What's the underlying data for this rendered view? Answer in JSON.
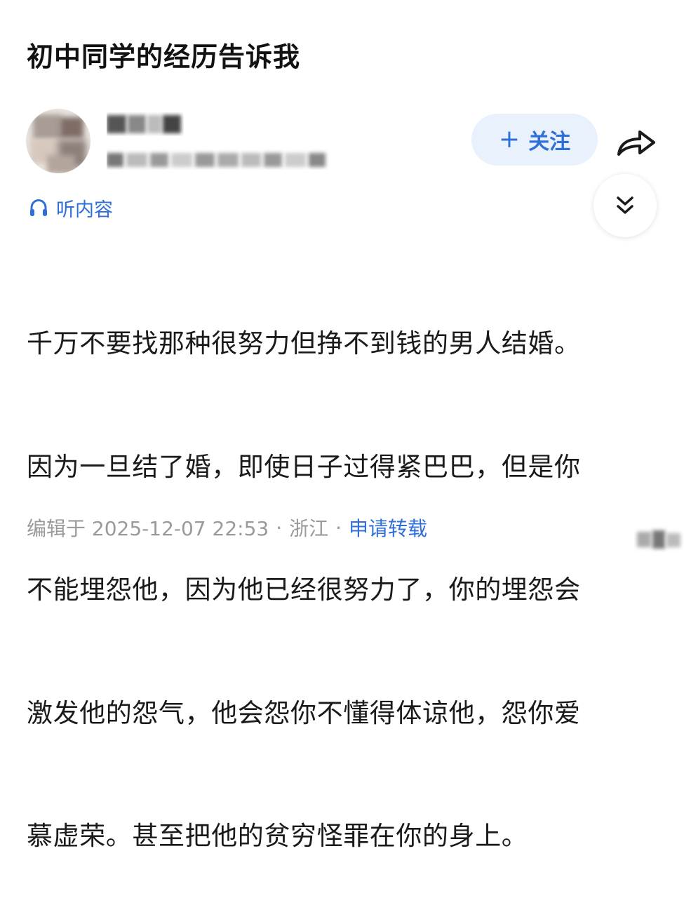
{
  "post": {
    "title": "初中同学的经历告诉我"
  },
  "author": {
    "follow_label": "关注",
    "follow_plus": "+"
  },
  "listen": {
    "label": "听内容"
  },
  "content": {
    "lines": [
      "千万不要找那种很努力但挣不到钱的男人结婚。",
      "因为一旦结了婚，即使日子过得紧巴巴，但是你",
      "不能埋怨他，因为他已经很努力了，你的埋怨会",
      "激发他的怨气，他会怨你不懂得体谅他，怨你爱",
      "慕虚荣。甚至把他的贫穷怪罪在你的身上。"
    ]
  },
  "footer": {
    "edited": "编辑于 2025-12-07 22:53",
    "sep": "·",
    "location": "浙江",
    "repost": "申请转载"
  },
  "colors": {
    "accent": "#2f6fd8",
    "follow_bg": "#e9f1fd",
    "meta_gray": "#9a9a9a"
  },
  "icons": {
    "listen": "headphones-icon",
    "share": "share-arrow-icon",
    "collapse": "double-chevron-down-icon"
  }
}
